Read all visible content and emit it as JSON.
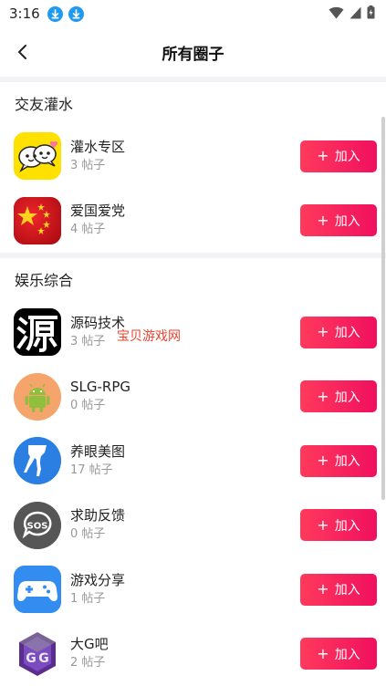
{
  "status": {
    "time": "3:16"
  },
  "header": {
    "title": "所有圈子"
  },
  "sections": [
    {
      "title": "交友灌水",
      "items": [
        {
          "name": "灌水专区",
          "count": "3 帖子",
          "icon": "chat-bubbles-icon"
        },
        {
          "name": "爱国爱党",
          "count": "4 帖子",
          "icon": "china-flag-icon"
        }
      ]
    },
    {
      "title": "娱乐综合",
      "items": [
        {
          "name": "源码技术",
          "count": "3 帖子",
          "icon": "yuan-character-icon"
        },
        {
          "name": "SLG-RPG",
          "count": "0 帖子",
          "icon": "android-robot-icon"
        },
        {
          "name": "养眼美图",
          "count": "17 帖子",
          "icon": "legs-icon"
        },
        {
          "name": "求助反馈",
          "count": "0 帖子",
          "icon": "sos-bubble-icon"
        },
        {
          "name": "游戏分享",
          "count": "1 帖子",
          "icon": "gamepad-icon"
        },
        {
          "name": "大G吧",
          "count": "2 帖子",
          "icon": "gg-shield-icon"
        }
      ]
    }
  ],
  "join_label": "加入",
  "join_plus": "+",
  "watermark": "宝贝游戏网",
  "colors": {
    "accent": "#f0105f",
    "accent_start": "#ff3a5c",
    "download_badge": "#1e9bf0"
  }
}
